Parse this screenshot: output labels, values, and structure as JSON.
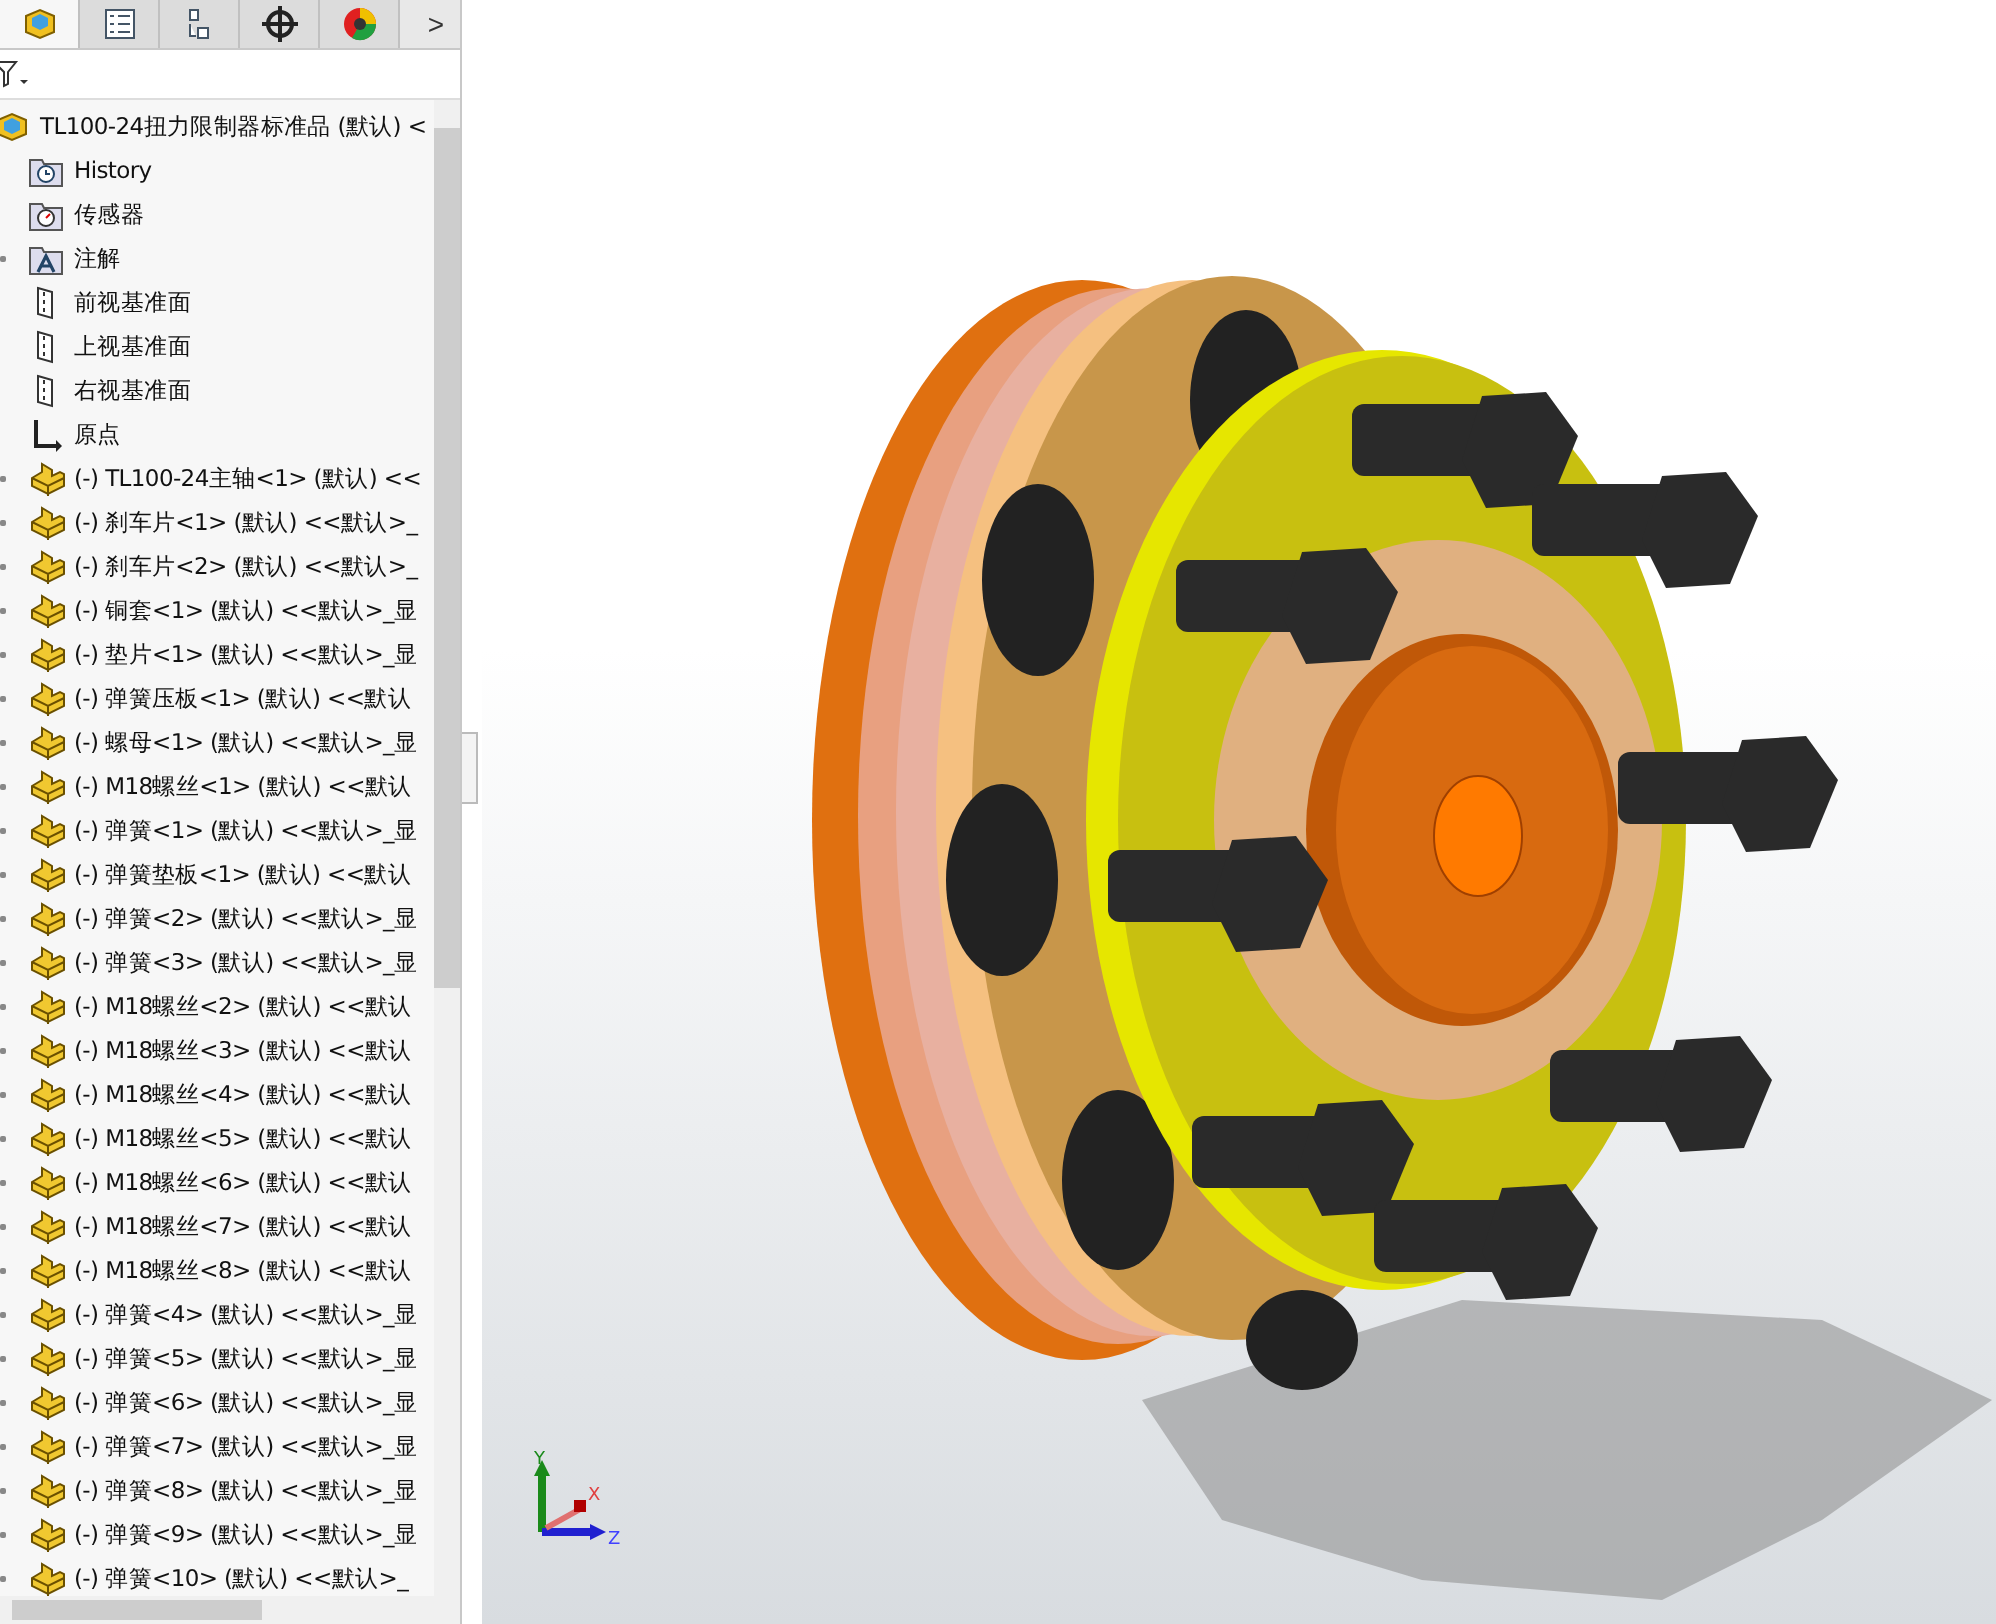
{
  "panel_tabs": [
    {
      "kind": "assembly",
      "selected": true
    },
    {
      "kind": "properties",
      "selected": false
    },
    {
      "kind": "config",
      "selected": false
    },
    {
      "kind": "dim",
      "selected": false
    },
    {
      "kind": "display",
      "selected": false
    }
  ],
  "tabs_more": ">",
  "tree": {
    "root": "TL100-24扭力限制器标准品 (默认) <",
    "items": [
      {
        "kind": "history",
        "label": "History",
        "expandable": false
      },
      {
        "kind": "sensor",
        "label": "传感器",
        "expandable": false
      },
      {
        "kind": "annotation",
        "label": "注解",
        "expandable": true
      },
      {
        "kind": "plane",
        "label": "前视基准面",
        "expandable": false
      },
      {
        "kind": "plane",
        "label": "上视基准面",
        "expandable": false
      },
      {
        "kind": "plane",
        "label": "右视基准面",
        "expandable": false
      },
      {
        "kind": "origin",
        "label": "原点",
        "expandable": false
      },
      {
        "kind": "part",
        "label": "(-) TL100-24主轴<1> (默认) <<",
        "expandable": true
      },
      {
        "kind": "part",
        "label": "(-) 刹车片<1> (默认) <<默认>_",
        "expandable": true
      },
      {
        "kind": "part",
        "label": "(-) 刹车片<2> (默认) <<默认>_",
        "expandable": true
      },
      {
        "kind": "part",
        "label": "(-) 铜套<1> (默认) <<默认>_显",
        "expandable": true
      },
      {
        "kind": "part",
        "label": "(-) 垫片<1> (默认) <<默认>_显",
        "expandable": true
      },
      {
        "kind": "part",
        "label": "(-) 弹簧压板<1> (默认) <<默认",
        "expandable": true
      },
      {
        "kind": "part",
        "label": "(-) 螺母<1> (默认) <<默认>_显",
        "expandable": true
      },
      {
        "kind": "part",
        "label": "(-) M18螺丝<1> (默认) <<默认",
        "expandable": true
      },
      {
        "kind": "part",
        "label": "(-) 弹簧<1> (默认) <<默认>_显",
        "expandable": true
      },
      {
        "kind": "part",
        "label": "(-) 弹簧垫板<1> (默认) <<默认",
        "expandable": true
      },
      {
        "kind": "part",
        "label": "(-) 弹簧<2> (默认) <<默认>_显",
        "expandable": true
      },
      {
        "kind": "part",
        "label": "(-) 弹簧<3> (默认) <<默认>_显",
        "expandable": true
      },
      {
        "kind": "part",
        "label": "(-) M18螺丝<2> (默认) <<默认",
        "expandable": true
      },
      {
        "kind": "part",
        "label": "(-) M18螺丝<3> (默认) <<默认",
        "expandable": true
      },
      {
        "kind": "part",
        "label": "(-) M18螺丝<4> (默认) <<默认",
        "expandable": true
      },
      {
        "kind": "part",
        "label": "(-) M18螺丝<5> (默认) <<默认",
        "expandable": true
      },
      {
        "kind": "part",
        "label": "(-) M18螺丝<6> (默认) <<默认",
        "expandable": true
      },
      {
        "kind": "part",
        "label": "(-) M18螺丝<7> (默认) <<默认",
        "expandable": true
      },
      {
        "kind": "part",
        "label": "(-) M18螺丝<8> (默认) <<默认",
        "expandable": true
      },
      {
        "kind": "part",
        "label": "(-) 弹簧<4> (默认) <<默认>_显",
        "expandable": true
      },
      {
        "kind": "part",
        "label": "(-) 弹簧<5> (默认) <<默认>_显",
        "expandable": true
      },
      {
        "kind": "part",
        "label": "(-) 弹簧<6> (默认) <<默认>_显",
        "expandable": true
      },
      {
        "kind": "part",
        "label": "(-) 弹簧<7> (默认) <<默认>_显",
        "expandable": true
      },
      {
        "kind": "part",
        "label": "(-) 弹簧<8> (默认) <<默认>_显",
        "expandable": true
      },
      {
        "kind": "part",
        "label": "(-) 弹簧<9> (默认) <<默认>_显",
        "expandable": true
      },
      {
        "kind": "part",
        "label": "(-) 弹簧<10> (默认) <<默认>_",
        "expandable": true
      }
    ]
  },
  "triad": {
    "x": "X",
    "y": "Y",
    "z": "Z"
  }
}
